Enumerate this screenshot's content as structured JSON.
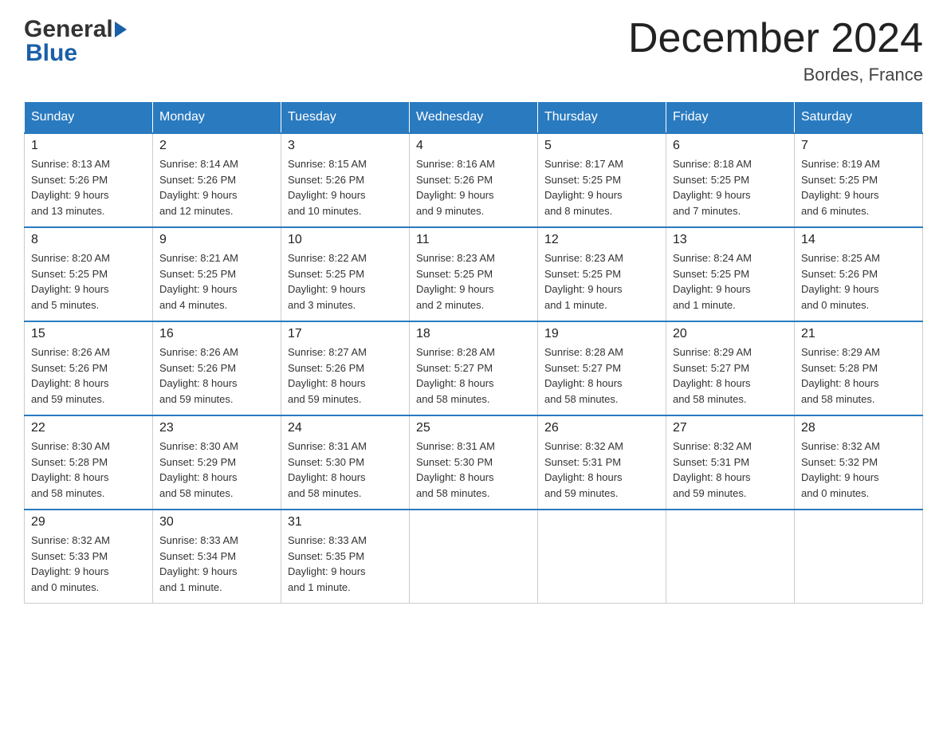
{
  "header": {
    "logo_text_general": "General",
    "logo_text_blue": "Blue",
    "month_title": "December 2024",
    "location": "Bordes, France"
  },
  "weekdays": [
    "Sunday",
    "Monday",
    "Tuesday",
    "Wednesday",
    "Thursday",
    "Friday",
    "Saturday"
  ],
  "weeks": [
    [
      {
        "day": "1",
        "sunrise": "8:13 AM",
        "sunset": "5:26 PM",
        "daylight": "9 hours and 13 minutes."
      },
      {
        "day": "2",
        "sunrise": "8:14 AM",
        "sunset": "5:26 PM",
        "daylight": "9 hours and 12 minutes."
      },
      {
        "day": "3",
        "sunrise": "8:15 AM",
        "sunset": "5:26 PM",
        "daylight": "9 hours and 10 minutes."
      },
      {
        "day": "4",
        "sunrise": "8:16 AM",
        "sunset": "5:26 PM",
        "daylight": "9 hours and 9 minutes."
      },
      {
        "day": "5",
        "sunrise": "8:17 AM",
        "sunset": "5:25 PM",
        "daylight": "9 hours and 8 minutes."
      },
      {
        "day": "6",
        "sunrise": "8:18 AM",
        "sunset": "5:25 PM",
        "daylight": "9 hours and 7 minutes."
      },
      {
        "day": "7",
        "sunrise": "8:19 AM",
        "sunset": "5:25 PM",
        "daylight": "9 hours and 6 minutes."
      }
    ],
    [
      {
        "day": "8",
        "sunrise": "8:20 AM",
        "sunset": "5:25 PM",
        "daylight": "9 hours and 5 minutes."
      },
      {
        "day": "9",
        "sunrise": "8:21 AM",
        "sunset": "5:25 PM",
        "daylight": "9 hours and 4 minutes."
      },
      {
        "day": "10",
        "sunrise": "8:22 AM",
        "sunset": "5:25 PM",
        "daylight": "9 hours and 3 minutes."
      },
      {
        "day": "11",
        "sunrise": "8:23 AM",
        "sunset": "5:25 PM",
        "daylight": "9 hours and 2 minutes."
      },
      {
        "day": "12",
        "sunrise": "8:23 AM",
        "sunset": "5:25 PM",
        "daylight": "9 hours and 1 minute."
      },
      {
        "day": "13",
        "sunrise": "8:24 AM",
        "sunset": "5:25 PM",
        "daylight": "9 hours and 1 minute."
      },
      {
        "day": "14",
        "sunrise": "8:25 AM",
        "sunset": "5:26 PM",
        "daylight": "9 hours and 0 minutes."
      }
    ],
    [
      {
        "day": "15",
        "sunrise": "8:26 AM",
        "sunset": "5:26 PM",
        "daylight": "8 hours and 59 minutes."
      },
      {
        "day": "16",
        "sunrise": "8:26 AM",
        "sunset": "5:26 PM",
        "daylight": "8 hours and 59 minutes."
      },
      {
        "day": "17",
        "sunrise": "8:27 AM",
        "sunset": "5:26 PM",
        "daylight": "8 hours and 59 minutes."
      },
      {
        "day": "18",
        "sunrise": "8:28 AM",
        "sunset": "5:27 PM",
        "daylight": "8 hours and 58 minutes."
      },
      {
        "day": "19",
        "sunrise": "8:28 AM",
        "sunset": "5:27 PM",
        "daylight": "8 hours and 58 minutes."
      },
      {
        "day": "20",
        "sunrise": "8:29 AM",
        "sunset": "5:27 PM",
        "daylight": "8 hours and 58 minutes."
      },
      {
        "day": "21",
        "sunrise": "8:29 AM",
        "sunset": "5:28 PM",
        "daylight": "8 hours and 58 minutes."
      }
    ],
    [
      {
        "day": "22",
        "sunrise": "8:30 AM",
        "sunset": "5:28 PM",
        "daylight": "8 hours and 58 minutes."
      },
      {
        "day": "23",
        "sunrise": "8:30 AM",
        "sunset": "5:29 PM",
        "daylight": "8 hours and 58 minutes."
      },
      {
        "day": "24",
        "sunrise": "8:31 AM",
        "sunset": "5:30 PM",
        "daylight": "8 hours and 58 minutes."
      },
      {
        "day": "25",
        "sunrise": "8:31 AM",
        "sunset": "5:30 PM",
        "daylight": "8 hours and 58 minutes."
      },
      {
        "day": "26",
        "sunrise": "8:32 AM",
        "sunset": "5:31 PM",
        "daylight": "8 hours and 59 minutes."
      },
      {
        "day": "27",
        "sunrise": "8:32 AM",
        "sunset": "5:31 PM",
        "daylight": "8 hours and 59 minutes."
      },
      {
        "day": "28",
        "sunrise": "8:32 AM",
        "sunset": "5:32 PM",
        "daylight": "9 hours and 0 minutes."
      }
    ],
    [
      {
        "day": "29",
        "sunrise": "8:32 AM",
        "sunset": "5:33 PM",
        "daylight": "9 hours and 0 minutes."
      },
      {
        "day": "30",
        "sunrise": "8:33 AM",
        "sunset": "5:34 PM",
        "daylight": "9 hours and 1 minute."
      },
      {
        "day": "31",
        "sunrise": "8:33 AM",
        "sunset": "5:35 PM",
        "daylight": "9 hours and 1 minute."
      },
      null,
      null,
      null,
      null
    ]
  ]
}
